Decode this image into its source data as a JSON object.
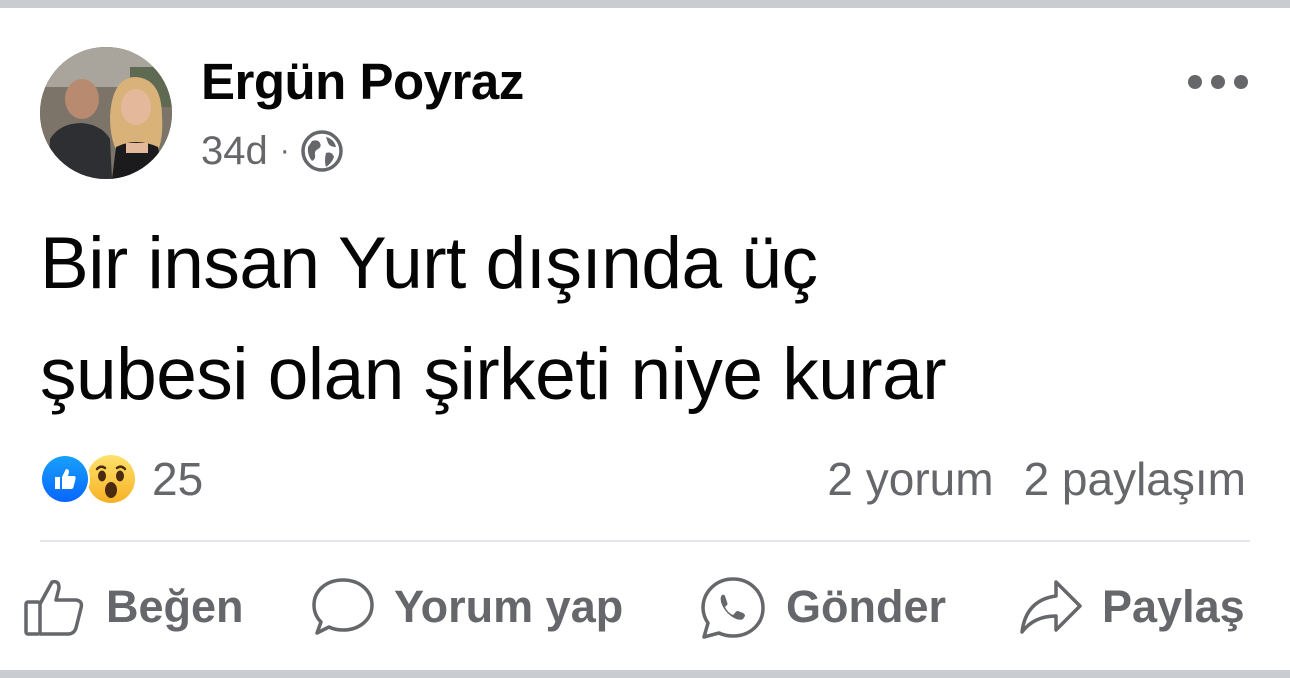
{
  "post": {
    "author": "Ergün Poyraz",
    "time": "34d",
    "separator": "·",
    "audience_icon": "globe-icon",
    "text_lines": [
      "Bir insan Yurt dışında üç",
      "şubesi olan şirketi niye kurar"
    ]
  },
  "reactions": {
    "icons": [
      "like-icon",
      "wow-icon"
    ],
    "count": "25"
  },
  "stats": {
    "comments": "2 yorum",
    "shares": "2 paylaşım"
  },
  "actions": {
    "like": "Beğen",
    "comment": "Yorum yap",
    "send": "Gönder",
    "share": "Paylaş"
  },
  "colors": {
    "primary_text": "#050505",
    "secondary_text": "#65676b",
    "like_blue": "#0866ff",
    "divider": "#e4e6eb"
  }
}
